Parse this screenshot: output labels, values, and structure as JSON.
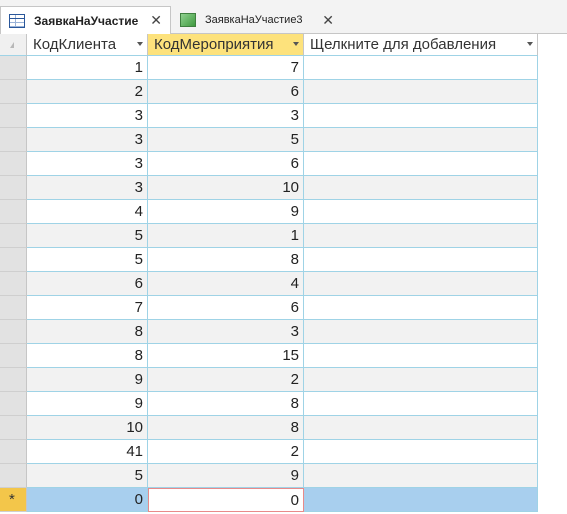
{
  "tabs": [
    {
      "label": "ЗаявкаНаУчастие",
      "icon": "table-icon",
      "active": true
    },
    {
      "label": "ЗаявкаНаУчастие3",
      "icon": "form-icon",
      "active": false
    }
  ],
  "columns": [
    {
      "label": "КодКлиента"
    },
    {
      "label": "КодМероприятия"
    },
    {
      "label": "Щелкните для добавления"
    }
  ],
  "rows": [
    {
      "client": "1",
      "event": "7"
    },
    {
      "client": "2",
      "event": "6"
    },
    {
      "client": "3",
      "event": "3"
    },
    {
      "client": "3",
      "event": "5"
    },
    {
      "client": "3",
      "event": "6"
    },
    {
      "client": "3",
      "event": "10"
    },
    {
      "client": "4",
      "event": "9"
    },
    {
      "client": "5",
      "event": "1"
    },
    {
      "client": "5",
      "event": "8"
    },
    {
      "client": "6",
      "event": "4"
    },
    {
      "client": "7",
      "event": "6"
    },
    {
      "client": "8",
      "event": "3"
    },
    {
      "client": "8",
      "event": "15"
    },
    {
      "client": "9",
      "event": "2"
    },
    {
      "client": "9",
      "event": "8"
    },
    {
      "client": "10",
      "event": "8"
    },
    {
      "client": "41",
      "event": "2"
    },
    {
      "client": "5",
      "event": "9"
    }
  ],
  "new_row": {
    "marker": "*",
    "client": "0",
    "event": "0"
  },
  "colors": {
    "selected_header": "#fde27c",
    "new_row": "#a8cfee",
    "gridline": "#9fd3e6"
  }
}
